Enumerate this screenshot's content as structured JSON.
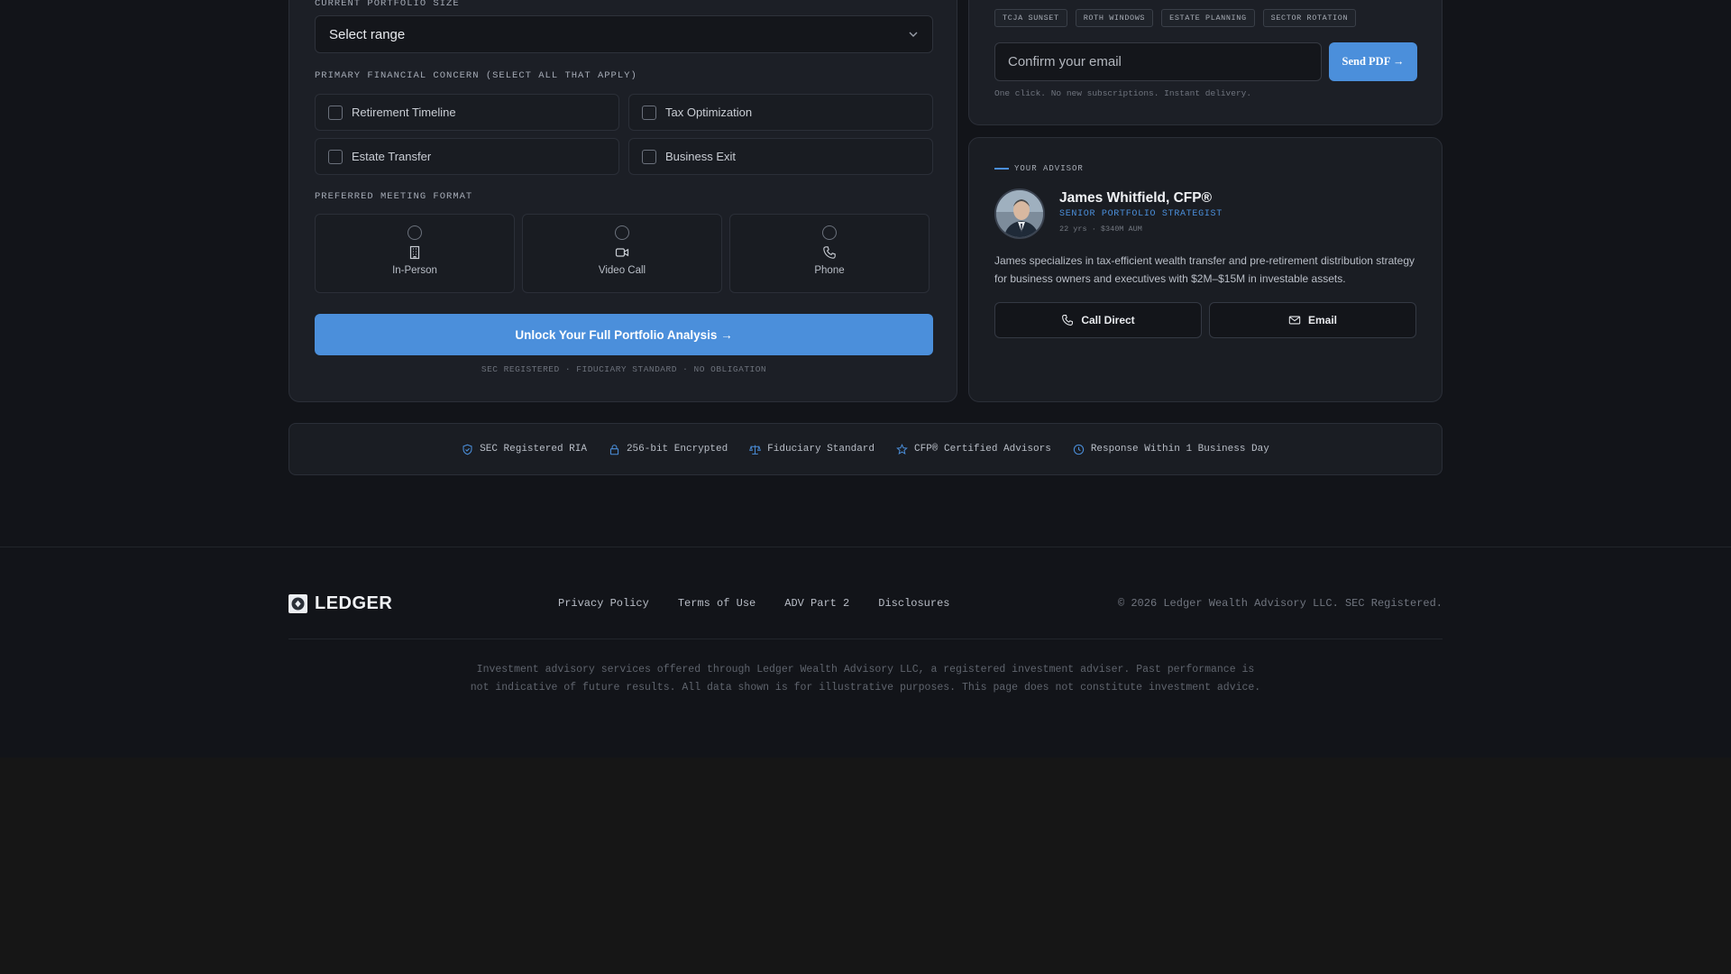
{
  "form": {
    "portfolio_label": "CURRENT PORTFOLIO SIZE",
    "portfolio_select": "Select range",
    "concern_label": "PRIMARY FINANCIAL CONCERN (SELECT ALL THAT APPLY)",
    "concerns": [
      "Retirement Timeline",
      "Tax Optimization",
      "Estate Transfer",
      "Business Exit"
    ],
    "format_label": "PREFERRED MEETING FORMAT",
    "formats": [
      {
        "label": "In-Person",
        "icon": "building-icon"
      },
      {
        "label": "Video Call",
        "icon": "video-icon"
      },
      {
        "label": "Phone",
        "icon": "phone-icon"
      }
    ],
    "cta": "Unlock Your Full Portfolio Analysis →",
    "cta_note": "SEC REGISTERED · FIDUCIARY STANDARD · NO OBLIGATION"
  },
  "pdf": {
    "tags": [
      "TCJA SUNSET",
      "ROTH WINDOWS",
      "ESTATE PLANNING",
      "SECTOR ROTATION"
    ],
    "email_placeholder": "Confirm your email",
    "send_label": "Send PDF →",
    "note": "One click. No new subscriptions. Instant delivery."
  },
  "advisor": {
    "caption": "YOUR ADVISOR",
    "name": "James Whitfield, CFP®",
    "title": "SENIOR PORTFOLIO STRATEGIST",
    "meta": "22 yrs · $340M AUM",
    "bio": "James specializes in tax-efficient wealth transfer and pre-retirement distribution strategy for business owners and executives with $2M–$15M in investable assets.",
    "call_label": "Call Direct",
    "email_label": "Email"
  },
  "trust": [
    "SEC Registered RIA",
    "256-bit Encrypted",
    "Fiduciary Standard",
    "CFP® Certified Advisors",
    "Response Within 1 Business Day"
  ],
  "footer": {
    "brand": "LEDGER",
    "links": [
      "Privacy Policy",
      "Terms of Use",
      "ADV Part 2",
      "Disclosures"
    ],
    "copyright": "© 2026 Ledger Wealth Advisory LLC. SEC Registered.",
    "disclaimer": "Investment advisory services offered through Ledger Wealth Advisory LLC, a registered investment adviser. Past performance is not indicative of future results. All data shown is for illustrative purposes. This page does not constitute investment advice."
  },
  "colors": {
    "accent": "#4b8fdb",
    "background": "#121419",
    "card": "#1c1f26"
  }
}
